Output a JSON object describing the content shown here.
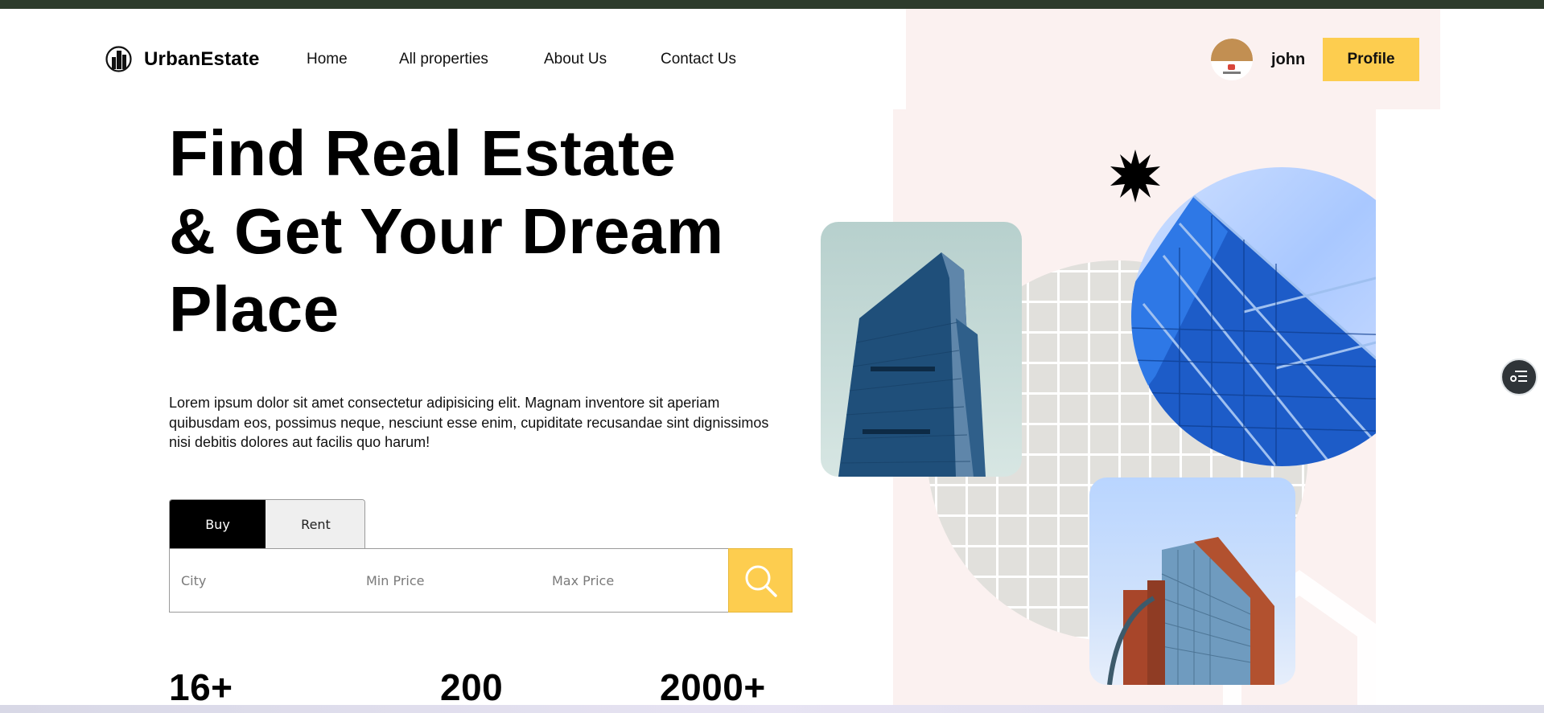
{
  "brand": {
    "name": "UrbanEstate"
  },
  "nav": {
    "items": [
      "Home",
      "All properties",
      "About Us",
      "Contact Us"
    ]
  },
  "user": {
    "name": "john",
    "profile_label": "Profile"
  },
  "hero": {
    "title": "Find Real Estate & Get Your Dream Place",
    "description": "Lorem ipsum dolor sit amet consectetur adipisicing elit. Magnam inventore sit aperiam quibusdam eos, possimus neque, nesciunt esse enim, cupiditate recusandae sint dignissimos nisi debitis dolores aut facilis quo harum!"
  },
  "search": {
    "tabs": {
      "buy": "Buy",
      "rent": "Rent",
      "active": "Buy"
    },
    "city_placeholder": "City",
    "min_price_placeholder": "Min Price",
    "max_price_placeholder": "Max Price"
  },
  "stats": [
    "16+",
    "200",
    "2000+"
  ],
  "icons": {
    "logo": "building-logo-icon",
    "search": "search-icon",
    "star": "starburst-icon",
    "floating": "list-menu-icon"
  },
  "colors": {
    "accent": "#fdcd4f",
    "top_bar": "#2d3b2c",
    "pink_bg": "#fbf1f0",
    "tab_active": "#000000",
    "tab_inactive": "#efefef"
  }
}
